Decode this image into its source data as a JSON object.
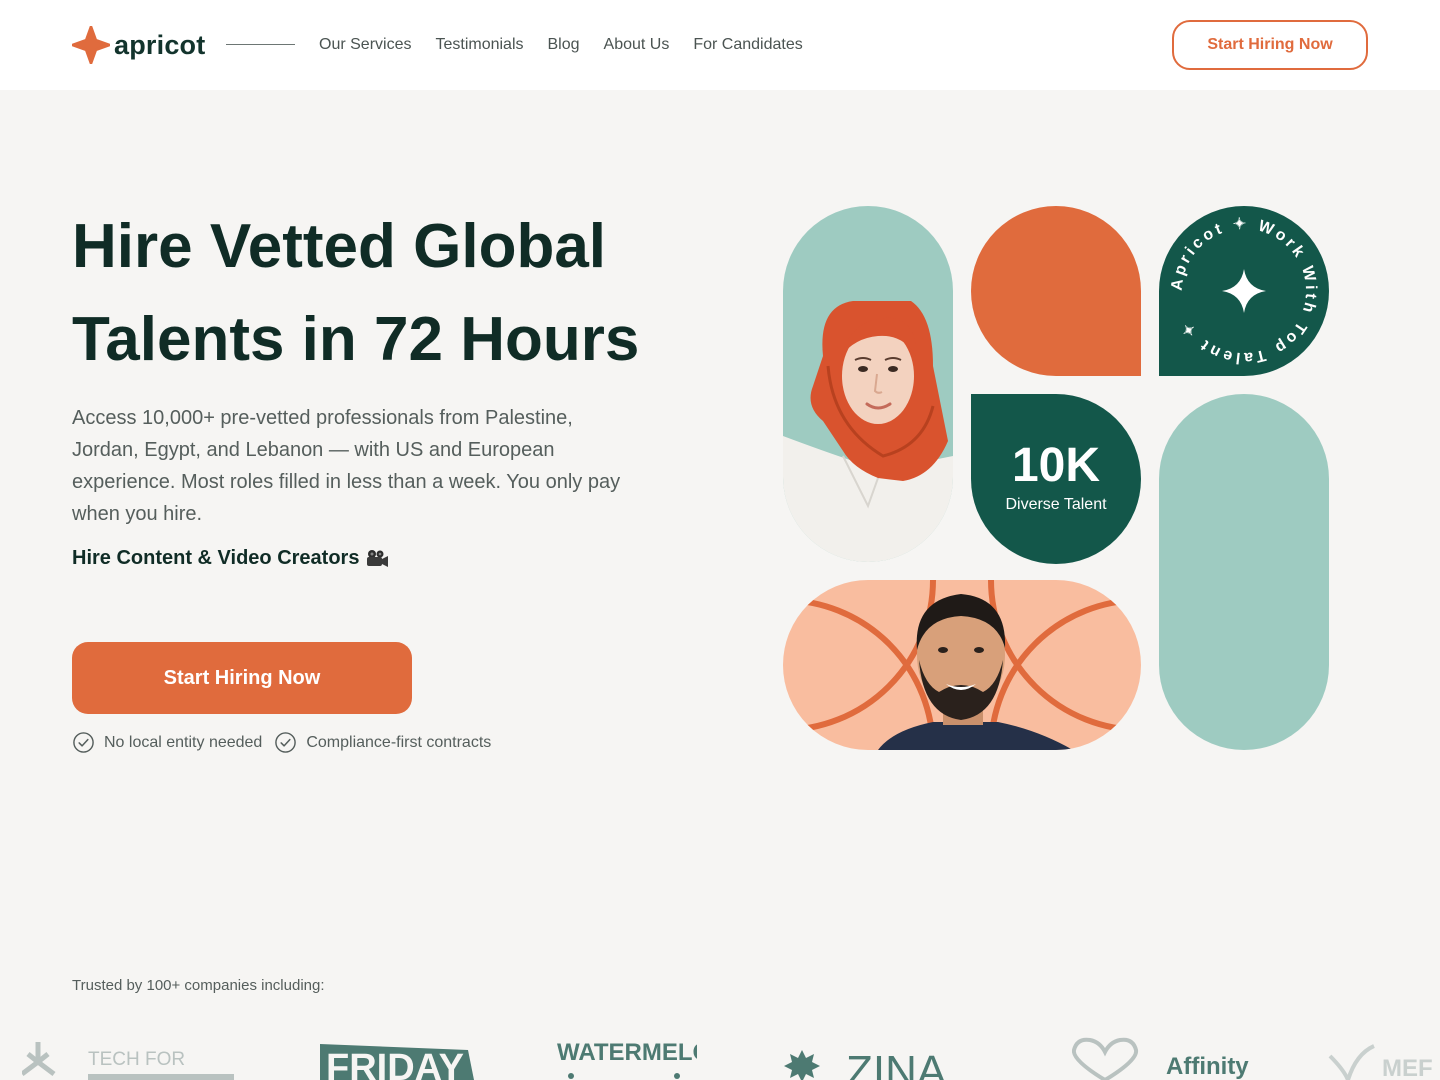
{
  "brand": {
    "name": "apricot",
    "accent": "#e06b3d",
    "dark": "#13574a",
    "mint": "#9ecbc1",
    "peach": "#f9bd9f"
  },
  "nav": {
    "items": [
      "Our Services",
      "Testimonials",
      "Blog",
      "About Us",
      "For Candidates"
    ],
    "cta": "Start Hiring Now"
  },
  "hero": {
    "title_line1": "Hire Vetted Global",
    "title_line2": "Talents in 72 Hours",
    "description": "Access 10,000+ pre-vetted professionals from Palestine, Jordan, Egypt, and Lebanon — with US and European experience. Most roles filled in less than a week. You only pay when you hire.",
    "subheading": "Hire Content & Video Creators",
    "subheading_icon": "video-camera-icon",
    "cta": "Start Hiring Now",
    "checks": [
      "No local entity needed",
      "Compliance-first contracts"
    ]
  },
  "grid": {
    "stat_value": "10K",
    "stat_label": "Diverse Talent",
    "badge_text": "Apricot ✦ Work With Top Talent ✦"
  },
  "trusted": {
    "label": "Trusted by 100+ companies including:",
    "logos": [
      "TECH FOR PALESTINE",
      "FRIDAY",
      "WATERMELON",
      "ZINA",
      "Affinity",
      "MEF"
    ]
  }
}
